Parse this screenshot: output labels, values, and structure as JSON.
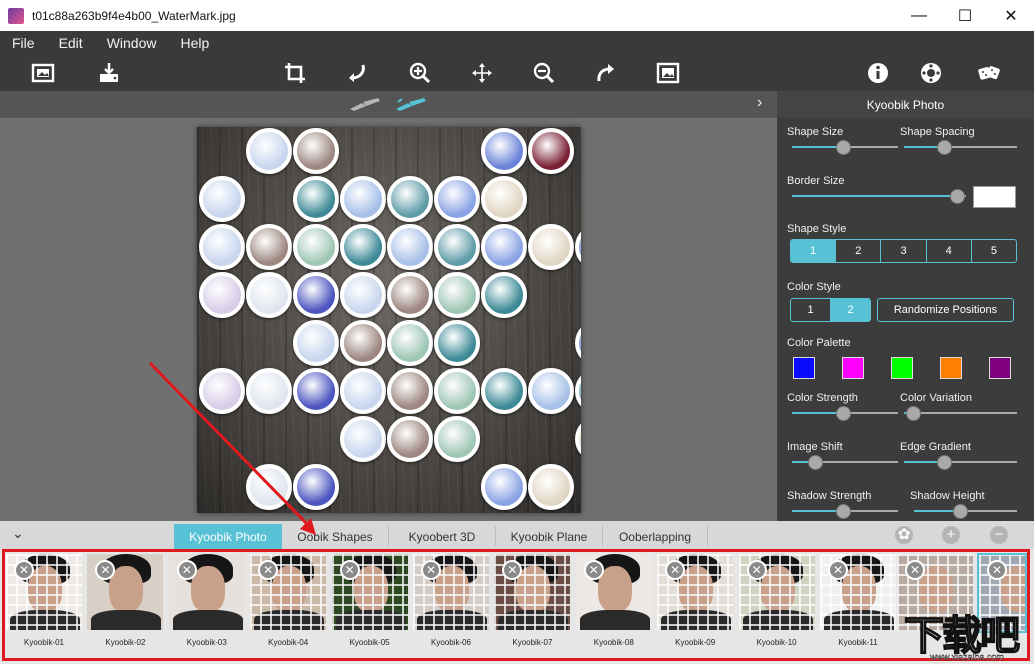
{
  "window": {
    "title": "t01c88a263b9f4e4b00_WaterMark.jpg",
    "minimize": "—",
    "maximize": "☐",
    "close": "✕"
  },
  "menu": [
    "File",
    "Edit",
    "Window",
    "Help"
  ],
  "toolbar": {
    "left": [
      "open-image-icon",
      "save-icon"
    ],
    "center": [
      "crop-icon",
      "undo-icon",
      "zoom-in-icon",
      "move-icon",
      "zoom-out-icon",
      "redo-icon",
      "fit-image-icon"
    ],
    "right": [
      "info-icon",
      "settings-icon",
      "randomize-dice-icon"
    ]
  },
  "panel": {
    "title": "Kyoobik Photo",
    "shape_size_label": "Shape Size",
    "shape_spacing_label": "Shape Spacing",
    "border_size_label": "Border Size",
    "shape_style_label": "Shape Style",
    "shape_style_options": [
      "1",
      "2",
      "3",
      "4",
      "5"
    ],
    "shape_style_selected": "1",
    "color_style_label": "Color Style",
    "color_style_options": [
      "1",
      "2"
    ],
    "color_style_selected": "2",
    "randomize_label": "Randomize Positions",
    "color_palette_label": "Color Palette",
    "palette": [
      "#0b0bff",
      "#ff00ff",
      "#00ff00",
      "#ff8000",
      "#800080"
    ],
    "border_color": "#ffffff",
    "color_strength_label": "Color Strength",
    "color_variation_label": "Color Variation",
    "image_shift_label": "Image Shift",
    "edge_gradient_label": "Edge Gradient",
    "shadow_strength_label": "Shadow Strength",
    "shadow_height_label": "Shadow Height",
    "values": {
      "shape_size": 0.48,
      "shape_spacing": 0.35,
      "border_size": 0.95,
      "color_strength": 0.48,
      "color_variation": 0.08,
      "image_shift": 0.22,
      "edge_gradient": 0.35,
      "shadow_strength": 0.48,
      "shadow_height": 0.45
    }
  },
  "tabs": [
    "Kyoobik Photo",
    "Oobik Shapes",
    "Kyoobert 3D",
    "Kyoobik Plane",
    "Ooberlapping"
  ],
  "active_tab": "Kyoobik Photo",
  "presets": [
    "Kyoobik-01",
    "Kyoobik-02",
    "Kyoobik-03",
    "Kyoobik-04",
    "Kyoobik-05",
    "Kyoobik-06",
    "Kyoobik-07",
    "Kyoobik-08",
    "Kyoobik-09",
    "Kyoobik-10",
    "Kyoobik-11"
  ],
  "watermark": {
    "logo": "下载吧",
    "url": "www.xiazaiba.com"
  },
  "accent": "#57c1d5"
}
